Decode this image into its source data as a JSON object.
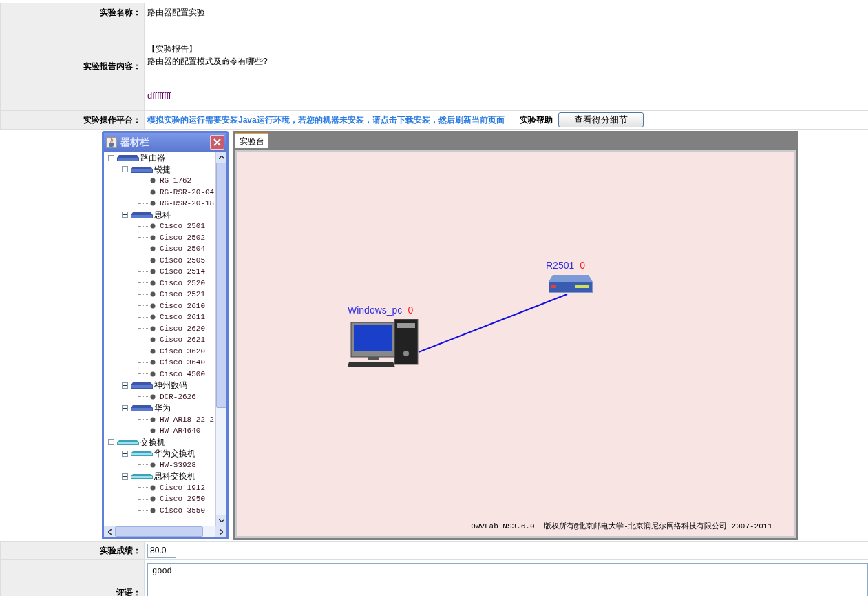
{
  "form": {
    "name_label": "实验名称：",
    "name_value": "路由器配置实验",
    "report_label": "实验报告内容：",
    "report_heading": "【实验报告】",
    "report_question": "路由器的配置模式及命令有哪些?",
    "report_answer": "dffffffff",
    "platform_label": "实验操作平台：",
    "java_notice": "模拟实验的运行需要安装Java运行环境，若您的机器未安装，请点击下载安装，然后刷新当前页面",
    "help_link": "实验帮助",
    "score_detail_button": "查看得分细节",
    "score_label": "实验成绩：",
    "score_value": "80.0",
    "comment_label": "评语：",
    "comment_value": "good"
  },
  "palette": {
    "title": "器材栏",
    "tree": [
      {
        "label": "路由器",
        "kind": "router",
        "expanded": true,
        "children": [
          {
            "label": "锐捷",
            "kind": "router",
            "expanded": true,
            "children": [
              {
                "label": "RG-1762"
              },
              {
                "label": "RG-RSR-20-04"
              },
              {
                "label": "RG-RSR-20-18"
              }
            ]
          },
          {
            "label": "思科",
            "kind": "router",
            "expanded": true,
            "children": [
              {
                "label": "Cisco 2501"
              },
              {
                "label": "Cisco 2502"
              },
              {
                "label": "Cisco 2504"
              },
              {
                "label": "Cisco 2505"
              },
              {
                "label": "Cisco 2514"
              },
              {
                "label": "Cisco 2520"
              },
              {
                "label": "Cisco 2521"
              },
              {
                "label": "Cisco 2610"
              },
              {
                "label": "Cisco 2611"
              },
              {
                "label": "Cisco 2620"
              },
              {
                "label": "Cisco 2621"
              },
              {
                "label": "Cisco 3620"
              },
              {
                "label": "Cisco 3640"
              },
              {
                "label": "Cisco 4500"
              }
            ]
          },
          {
            "label": "神州数码",
            "kind": "router",
            "expanded": true,
            "children": [
              {
                "label": "DCR-2626"
              }
            ]
          },
          {
            "label": "华为",
            "kind": "router",
            "expanded": true,
            "children": [
              {
                "label": "HW-AR18_22_2"
              },
              {
                "label": "HW-AR4640"
              }
            ]
          }
        ]
      },
      {
        "label": "交换机",
        "kind": "switch",
        "expanded": true,
        "children": [
          {
            "label": "华为交换机",
            "kind": "switch",
            "expanded": true,
            "children": [
              {
                "label": "HW-S3928"
              }
            ]
          },
          {
            "label": "思科交换机",
            "kind": "switch",
            "expanded": true,
            "children": [
              {
                "label": "Cisco 1912"
              },
              {
                "label": "Cisco 2950"
              },
              {
                "label": "Cisco 3550"
              }
            ]
          }
        ]
      }
    ]
  },
  "workbench": {
    "tabs": [
      {
        "label": "实验台",
        "selected": true
      }
    ],
    "nodes": [
      {
        "kind": "pc",
        "name": "Windows_pc",
        "count": "0"
      },
      {
        "kind": "router",
        "name": "R2501",
        "count": "0"
      }
    ],
    "footer": "OWVLab NS3.6.0  版权所有@北京邮电大学-北京润尼尔网络科技有限公司 2007-2011"
  }
}
